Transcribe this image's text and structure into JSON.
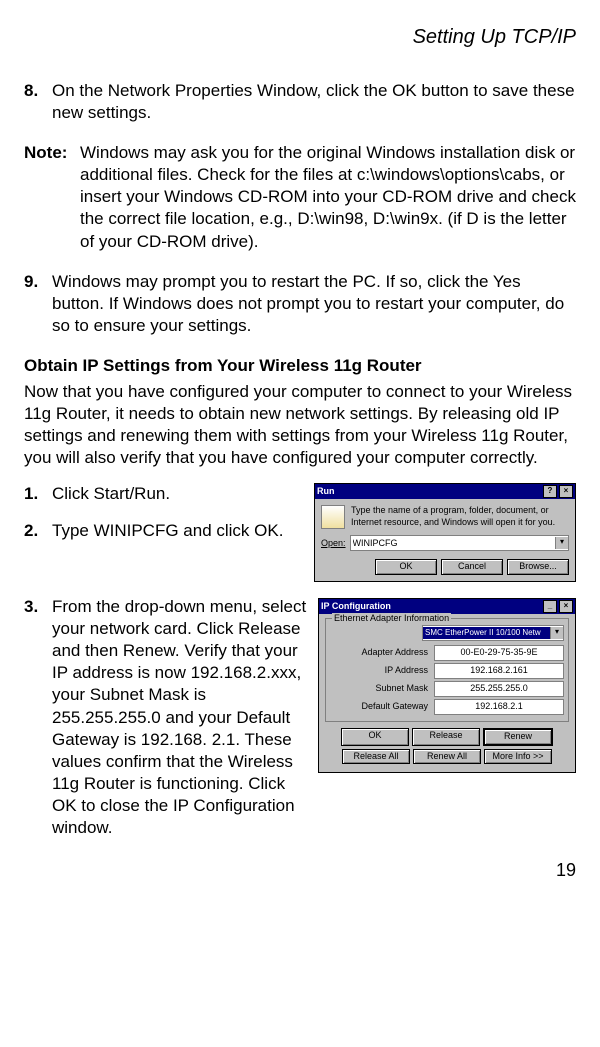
{
  "header": "Setting Up TCP/IP",
  "steps": {
    "s8": {
      "num": "8.",
      "text": "On the Network Properties Window, click the OK button to save these new settings."
    },
    "note": {
      "label": "Note:",
      "text": "Windows may ask you for the original Windows installation disk or additional files. Check for the files at c:\\windows\\options\\cabs, or insert your Windows CD-ROM into your CD-ROM drive and check the correct file location, e.g., D:\\win98, D:\\win9x. (if D is the letter of your CD-ROM drive)."
    },
    "s9": {
      "num": "9.",
      "text": "Windows may prompt you to restart the PC. If so, click the Yes button. If Windows does not prompt you to restart your computer, do so to ensure your settings."
    }
  },
  "subhead": "Obtain IP Settings from Your Wireless 11g Router",
  "intro": "Now that you have configured your computer to connect to your Wireless 11g Router, it needs to obtain new network settings. By releasing old IP settings and renewing them with settings from your Wireless 11g Router, you will also verify that you have configured your computer correctly.",
  "enumerated": {
    "e1": {
      "num": "1.",
      "text": "Click Start/Run."
    },
    "e2": {
      "num": "2.",
      "text": "Type WINIPCFG and click OK."
    },
    "e3": {
      "num": "3.",
      "text": "From the drop-down menu, select your network card. Click Release and then Renew. Verify that your IP address is now 192.168.2.xxx, your Subnet Mask is 255.255.255.0 and your Default Gateway is 192.168. 2.1. These values confirm that the Wireless 11g Router is functioning. Click OK to close the IP Configuration window."
    }
  },
  "run_dialog": {
    "title": "Run",
    "help_btn": "?",
    "close_btn": "×",
    "description": "Type the name of a program, folder, document, or Internet resource, and Windows will open it for you.",
    "open_label": "Open:",
    "open_value": "WINIPCFG",
    "ok": "OK",
    "cancel": "Cancel",
    "browse": "Browse..."
  },
  "ipconf": {
    "title": "IP Configuration",
    "min_btn": "_",
    "close_btn": "×",
    "group_title": "Ethernet Adapter Information",
    "adapter_selected": "SMC EtherPower II 10/100 Netw",
    "fields": {
      "adapter_address": {
        "label": "Adapter Address",
        "value": "00-E0-29-75-35-9E"
      },
      "ip_address": {
        "label": "IP Address",
        "value": "192.168.2.161"
      },
      "subnet_mask": {
        "label": "Subnet Mask",
        "value": "255.255.255.0"
      },
      "default_gateway": {
        "label": "Default Gateway",
        "value": "192.168.2.1"
      }
    },
    "buttons": {
      "ok": "OK",
      "release": "Release",
      "renew": "Renew",
      "release_all": "Release All",
      "renew_all": "Renew All",
      "more_info": "More Info >>"
    }
  },
  "page_number": "19"
}
